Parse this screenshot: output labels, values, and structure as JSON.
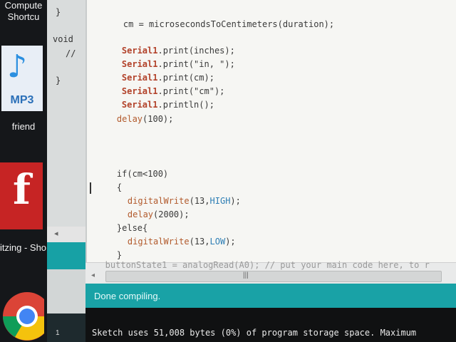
{
  "desktop": {
    "label_top": "Compute",
    "label_top2": "Shortcu",
    "mp3_label": "MP3",
    "friend_label": "friend",
    "shortcut_label": "itzing - Sho"
  },
  "back_window": {
    "lines": [
      "}",
      "void",
      "//",
      "}"
    ],
    "scroll_arrow": "◂",
    "line_number": "1"
  },
  "editor": {
    "line_cm": "cm = microsecondsToCentimeters(duration);",
    "serial_obj": "Serial1",
    "p1": ".print(inches);",
    "p2": ".print(\"in, \");",
    "p3": ".print(cm);",
    "p4": ".print(\"cm\");",
    "p5": ".println();",
    "delay_fn": "delay",
    "delay_args": "(100);",
    "if_line": "if(cm<100)",
    "brace_open": "{",
    "dw_fn": "digitalWrite",
    "dw1_pre": "(13,",
    "high": "HIGH",
    "dw_post": ");",
    "delay2_args": "(2000);",
    "else_line": "}else{",
    "low": "LOW",
    "brace_close": "}",
    "faded_line": "   buttonState1 = analogRead(A0); // put your main code here, to r"
  },
  "scrollbar": {
    "left_arrow": "◂",
    "grip": "|||"
  },
  "status": {
    "message": "Done compiling."
  },
  "console": {
    "message": "Sketch uses 51,008 bytes (0%) of program storage space. Maximum"
  }
}
